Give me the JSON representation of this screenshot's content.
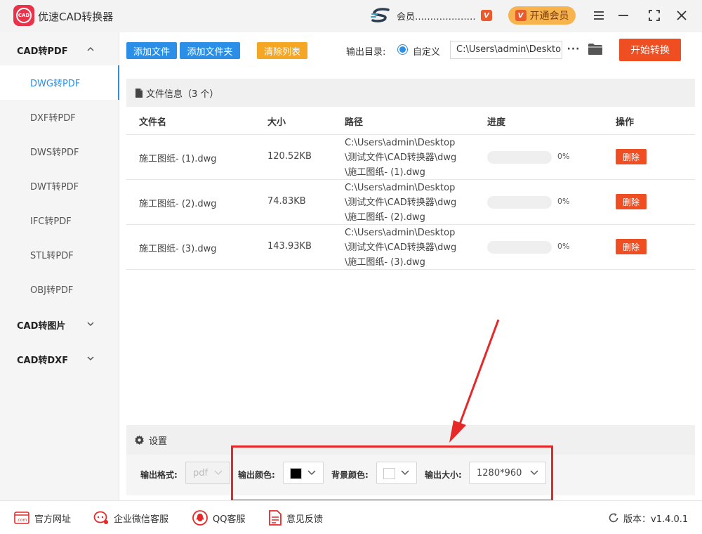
{
  "app": {
    "title": "优速CAD转换器",
    "logo_text": "CAD"
  },
  "user": {
    "name": "会员…………………"
  },
  "vip": {
    "label": "开通会员"
  },
  "sidebar": {
    "groups": [
      {
        "label": "CAD转PDF",
        "expanded": true
      },
      {
        "label": "CAD转图片",
        "expanded": false
      },
      {
        "label": "CAD转DXF",
        "expanded": false
      }
    ],
    "items": [
      {
        "label": "DWG转PDF",
        "active": true
      },
      {
        "label": "DXF转PDF"
      },
      {
        "label": "DWS转PDF"
      },
      {
        "label": "DWT转PDF"
      },
      {
        "label": "IFC转PDF"
      },
      {
        "label": "STL转PDF"
      },
      {
        "label": "OBJ转PDF"
      }
    ]
  },
  "toolbar": {
    "add_file": "添加文件",
    "add_folder": "添加文件夹",
    "clear_list": "清除列表",
    "output_dir_label": "输出目录:",
    "output_mode": "自定义",
    "output_path": "C:\\Users\\admin\\Desktop",
    "more": "···",
    "start": "开始转换"
  },
  "files": {
    "header": "文件信息（3 个）",
    "columns": [
      "文件名",
      "大小",
      "路径",
      "进度",
      "操作"
    ],
    "rows": [
      {
        "name": "施工图纸- (1).dwg",
        "size": "120.52KB",
        "path": [
          "C:\\Users\\admin\\Desktop",
          "\\测试文件\\CAD转换器\\dwg",
          "\\施工图纸- (1).dwg"
        ],
        "progress": 0,
        "progress_text": "0%",
        "action": "删除"
      },
      {
        "name": "施工图纸- (2).dwg",
        "size": "74.83KB",
        "path": [
          "C:\\Users\\admin\\Desktop",
          "\\测试文件\\CAD转换器\\dwg",
          "\\施工图纸- (2).dwg"
        ],
        "progress": 0,
        "progress_text": "0%",
        "action": "删除"
      },
      {
        "name": "施工图纸- (3).dwg",
        "size": "143.93KB",
        "path": [
          "C:\\Users\\admin\\Desktop",
          "\\测试文件\\CAD转换器\\dwg",
          "\\施工图纸- (3).dwg"
        ],
        "progress": 0,
        "progress_text": "0%",
        "action": "删除"
      }
    ]
  },
  "settings": {
    "title": "设置",
    "output_format_label": "输出格式:",
    "output_format_value": "pdf",
    "output_color_label": "输出颜色:",
    "output_color_value": "#000000",
    "bg_color_label": "背景颜色:",
    "bg_color_value": "#ffffff",
    "output_size_label": "输出大小:",
    "output_size_value": "1280*960"
  },
  "footer": {
    "links": [
      "官方网址",
      "企业微信客服",
      "QQ客服",
      "意见反馈"
    ],
    "version": "版本：v1.4.0.1"
  },
  "colors": {
    "accent": "#2b8fe8",
    "danger": "#ef4d22",
    "warning": "#f5a623",
    "annotation": "#e62828"
  }
}
